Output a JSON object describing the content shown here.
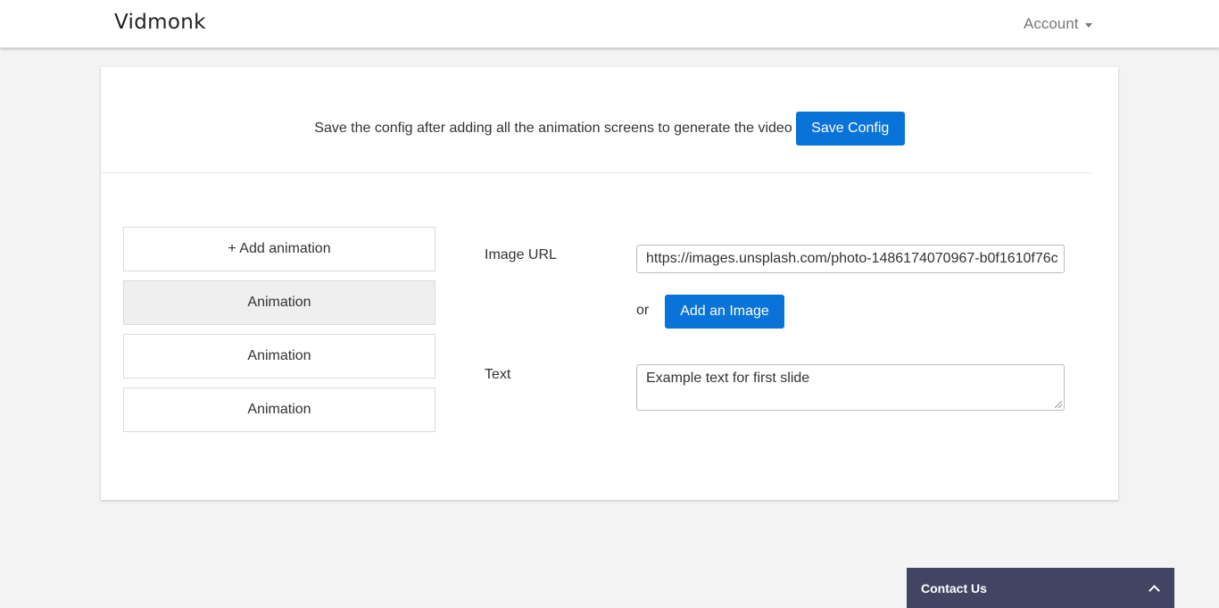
{
  "navbar": {
    "brand": "Vidmonk",
    "account_label": "Account"
  },
  "config": {
    "message": "Save the config after adding all the animation screens to generate the video",
    "save_label": "Save Config"
  },
  "animations": {
    "add_label": "+ Add animation",
    "items": [
      {
        "label": "Animation",
        "active": true
      },
      {
        "label": "Animation",
        "active": false
      },
      {
        "label": "Animation",
        "active": false
      }
    ]
  },
  "form": {
    "image_url_label": "Image URL",
    "image_url_value": "https://images.unsplash.com/photo-1486174070967-b0f1610f76c",
    "or_text": "or",
    "add_image_label": "Add an Image",
    "text_label": "Text",
    "text_value": "Example text for first slide"
  },
  "contact": {
    "label": "Contact Us"
  },
  "colors": {
    "primary": "#0a73d9",
    "contact_bg": "#414563",
    "page_bg": "#f3f3f3"
  }
}
